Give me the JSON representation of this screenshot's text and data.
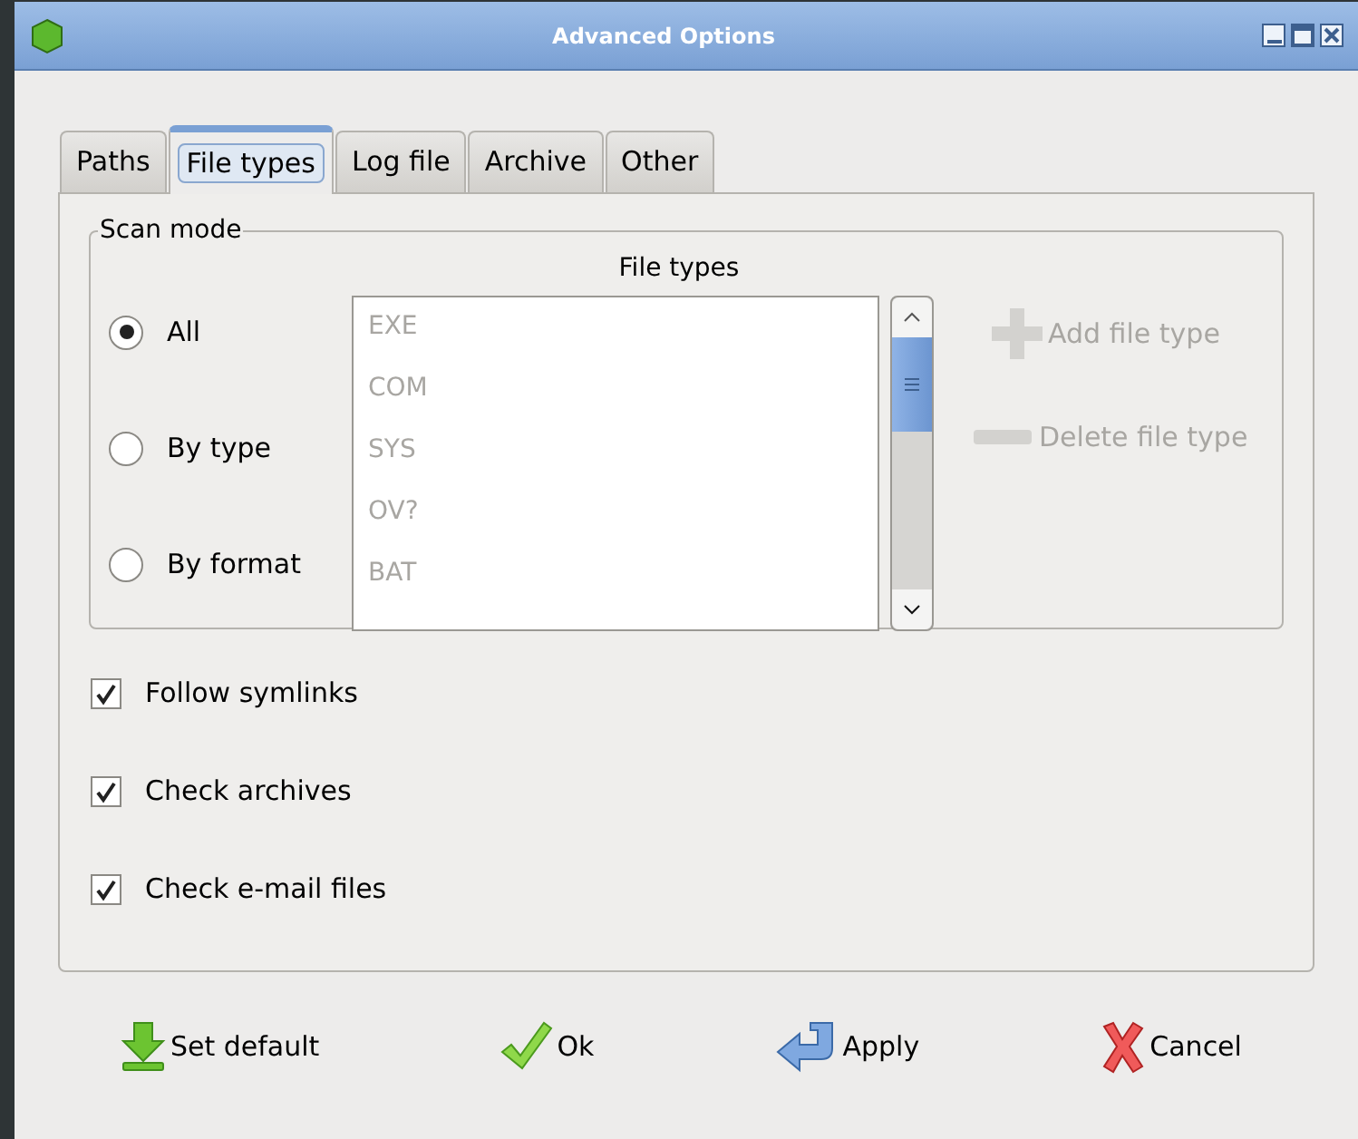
{
  "window": {
    "title": "Advanced Options"
  },
  "tabs": [
    {
      "label": "Paths",
      "selected": false
    },
    {
      "label": "File types",
      "selected": true
    },
    {
      "label": "Log file",
      "selected": false
    },
    {
      "label": "Archive",
      "selected": false
    },
    {
      "label": "Other",
      "selected": false
    }
  ],
  "scan_mode": {
    "title": "Scan mode",
    "options": [
      {
        "label": "All",
        "selected": true
      },
      {
        "label": "By type",
        "selected": false
      },
      {
        "label": "By format",
        "selected": false
      }
    ],
    "file_types": {
      "heading": "File types",
      "disabled": true,
      "items": [
        "EXE",
        "COM",
        "SYS",
        "OV?",
        "BAT"
      ]
    },
    "add_button": {
      "label": "Add file type",
      "disabled": true
    },
    "delete_button": {
      "label": "Delete file type",
      "disabled": true
    }
  },
  "checkboxes": [
    {
      "label": "Follow symlinks",
      "checked": true
    },
    {
      "label": "Check archives",
      "checked": true
    },
    {
      "label": "Check e-mail files",
      "checked": true
    }
  ],
  "buttons": [
    {
      "kind": "default",
      "label": "Set default"
    },
    {
      "kind": "ok",
      "label": "Ok"
    },
    {
      "kind": "apply",
      "label": "Apply"
    },
    {
      "kind": "cancel",
      "label": "Cancel"
    }
  ]
}
